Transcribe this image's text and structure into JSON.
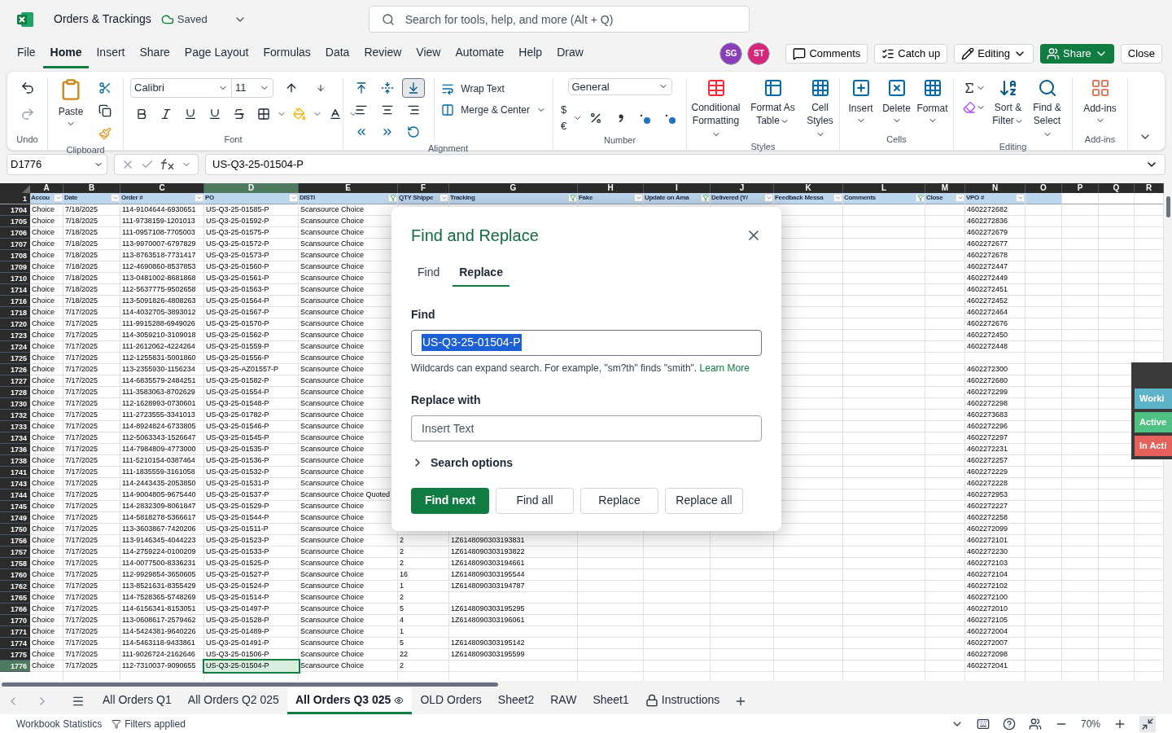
{
  "title_bar": {
    "file_name": "Orders & Trackings",
    "save_status": "Saved",
    "search": {
      "placeholder": "Search for tools, help, and more (Alt + Q)"
    }
  },
  "menu_tabs": [
    {
      "label": "File",
      "selected": false
    },
    {
      "label": "Home",
      "selected": true
    },
    {
      "label": "Insert",
      "selected": false
    },
    {
      "label": "Share",
      "selected": false
    },
    {
      "label": "Page Layout",
      "selected": false
    },
    {
      "label": "Formulas",
      "selected": false
    },
    {
      "label": "Data",
      "selected": false
    },
    {
      "label": "Review",
      "selected": false
    },
    {
      "label": "View",
      "selected": false
    },
    {
      "label": "Automate",
      "selected": false
    },
    {
      "label": "Help",
      "selected": false
    },
    {
      "label": "Draw",
      "selected": false
    }
  ],
  "collaborators": [
    {
      "initials": "SG",
      "color": "#8a3fb8"
    },
    {
      "initials": "ST",
      "color": "#d6287a"
    }
  ],
  "actions": {
    "comments": "Comments",
    "catch_up": "Catch up",
    "editing": "Editing",
    "share": "Share",
    "close": "Close"
  },
  "ribbon": {
    "undo_label": "Undo",
    "clipboard_label": "Clipboard",
    "paste": "Paste",
    "font_label": "Font",
    "font_name": "Calibri",
    "font_size": "11",
    "alignment_label": "Alignment",
    "vertical_align": [
      {
        "selected": false
      },
      {
        "selected": false
      },
      {
        "selected": true
      }
    ],
    "wrap_text": "Wrap Text",
    "merge": "Merge & Center",
    "number_label": "Number",
    "number_format": "General",
    "currency": "$€",
    "styles_label": "Styles",
    "styles": [
      "Conditional Formatting",
      "Format As Table",
      "Cell Styles"
    ],
    "cells_label": "Cells",
    "cells": [
      "Insert",
      "Delete",
      "Format"
    ],
    "editing_label": "Editing",
    "editing": [
      "Sort & Filter",
      "Find & Select"
    ],
    "addins_label": "Add-ins",
    "addins": "Add-ins"
  },
  "formula_bar": {
    "name_box": "D1776",
    "value": "US-Q3-25-01504-P"
  },
  "columns": [
    {
      "letter": "A",
      "header": "Accou",
      "in_table": true,
      "filtered": false,
      "selected": false
    },
    {
      "letter": "B",
      "header": "Date",
      "in_table": true,
      "filtered": false,
      "selected": false
    },
    {
      "letter": "C",
      "header": "Order #",
      "in_table": true,
      "filtered": false,
      "selected": false
    },
    {
      "letter": "D",
      "header": "PO",
      "in_table": true,
      "filtered": false,
      "selected": true
    },
    {
      "letter": "E",
      "header": "DISTI",
      "in_table": true,
      "filtered": true,
      "selected": false
    },
    {
      "letter": "F",
      "header": "QTY Shippe",
      "in_table": true,
      "filtered": false,
      "selected": false
    },
    {
      "letter": "G",
      "header": "Tracking",
      "in_table": true,
      "filtered": true,
      "selected": false
    },
    {
      "letter": "H",
      "header": "Fake",
      "in_table": true,
      "filtered": false,
      "selected": false
    },
    {
      "letter": "I",
      "header": "Update on Ama",
      "in_table": true,
      "filtered": true,
      "selected": false
    },
    {
      "letter": "J",
      "header": "Delivered (Y/",
      "in_table": true,
      "filtered": false,
      "selected": false
    },
    {
      "letter": "K",
      "header": "Feedback Messa",
      "in_table": true,
      "filtered": false,
      "selected": false
    },
    {
      "letter": "L",
      "header": "Comments",
      "in_table": true,
      "filtered": true,
      "selected": false
    },
    {
      "letter": "M",
      "header": "Close",
      "in_table": true,
      "filtered": false,
      "selected": false
    },
    {
      "letter": "N",
      "header": "VPO #",
      "in_table": true,
      "filtered": false,
      "selected": false
    },
    {
      "letter": "O",
      "in_table": true,
      "selected": false
    },
    {
      "letter": "P",
      "in_table": false,
      "selected": false
    },
    {
      "letter": "Q",
      "in_table": false,
      "selected": false
    },
    {
      "letter": "R",
      "in_table": false,
      "selected": false
    }
  ],
  "header_row_number": "1",
  "rows": [
    {
      "number": "1704",
      "selected": false,
      "cells": {
        "A": "Choice",
        "B": "7/18/2025",
        "C": "114-9104644-6930651",
        "D": "US-Q3-25-01585-P",
        "E": "Scansource Choice",
        "N": "4602272682"
      }
    },
    {
      "number": "1705",
      "selected": false,
      "cells": {
        "A": "Choice",
        "B": "7/18/2025",
        "C": "111-9738159-1201013",
        "D": "US-Q3-25-01592-P",
        "E": "Scansource Choice",
        "N": "4602272836"
      }
    },
    {
      "number": "1706",
      "selected": false,
      "cells": {
        "A": "Choice",
        "B": "7/18/2025",
        "C": "111-0957108-7705003",
        "D": "US-Q3-25-01575-P",
        "E": "Scansource Choice",
        "N": "4602272679"
      }
    },
    {
      "number": "1707",
      "selected": false,
      "cells": {
        "A": "Choice",
        "B": "7/18/2025",
        "C": "113-9970007-6797829",
        "D": "US-Q3-25-01572-P",
        "E": "Scansource Choice",
        "N": "4602272677"
      }
    },
    {
      "number": "1708",
      "selected": false,
      "cells": {
        "A": "Choice",
        "B": "7/18/2025",
        "C": "113-8763518-7731417",
        "D": "US-Q3-25-01573-P",
        "E": "Scansource Choice",
        "N": "4602272678"
      }
    },
    {
      "number": "1709",
      "selected": false,
      "cells": {
        "A": "Choice",
        "B": "7/18/2025",
        "C": "112-4690860-8537853",
        "D": "US-Q3-25-01560-P",
        "E": "Scansource Choice",
        "N": "4602272447"
      }
    },
    {
      "number": "1710",
      "selected": false,
      "cells": {
        "A": "Choice",
        "B": "7/18/2025",
        "C": "113-0481002-8681868",
        "D": "US-Q3-25-01561-P",
        "E": "Scansource Choice",
        "N": "4602272449"
      }
    },
    {
      "number": "1714",
      "selected": false,
      "cells": {
        "A": "Choice",
        "B": "7/18/2025",
        "C": "112-5637775-9502658",
        "D": "US-Q3-25-01563-P",
        "E": "Scansource Choice",
        "N": "4602272451"
      }
    },
    {
      "number": "1716",
      "selected": false,
      "cells": {
        "A": "Choice",
        "B": "7/18/2025",
        "C": "113-5091826-4808263",
        "D": "US-Q3-25-01564-P",
        "E": "Scansource Choice",
        "N": "4602272452"
      }
    },
    {
      "number": "1718",
      "selected": false,
      "cells": {
        "A": "Choice",
        "B": "7/17/2025",
        "C": "114-4032705-3893012",
        "D": "US-Q3-25-01567-P",
        "E": "Scansource Choice",
        "N": "4602272464"
      }
    },
    {
      "number": "1720",
      "selected": false,
      "cells": {
        "A": "Choice",
        "B": "7/17/2025",
        "C": "111-9915288-6949026",
        "D": "US-Q3-25-01570-P",
        "E": "Scansource Choice",
        "N": "4602272676"
      }
    },
    {
      "number": "1723",
      "selected": false,
      "cells": {
        "A": "Choice",
        "B": "7/17/2025",
        "C": "114-3059210-3109018",
        "D": "US-Q3-25-01562-P",
        "E": "Scansource Choice",
        "N": "4602272450"
      }
    },
    {
      "number": "1724",
      "selected": false,
      "cells": {
        "A": "Choice",
        "B": "7/17/2025",
        "C": "111-2612062-4224264",
        "D": "US-Q3-25-01559-P",
        "E": "Scansource Choice",
        "N": "4602272448"
      }
    },
    {
      "number": "1725",
      "selected": false,
      "cells": {
        "A": "Choice",
        "B": "7/17/2025",
        "C": "112-1255831-5001860",
        "D": "US-Q3-25-01556-P",
        "E": "Scansource Choice"
      }
    },
    {
      "number": "1726",
      "selected": false,
      "cells": {
        "A": "Choice",
        "B": "7/17/2025",
        "C": "113-2355930-1156234",
        "D": "US-Q3-25-AZ01557-P",
        "E": "Scansource Choice",
        "N": "4602272300"
      }
    },
    {
      "number": "1727",
      "selected": false,
      "cells": {
        "A": "Choice",
        "B": "7/17/2025",
        "C": "114-6835579-2484251",
        "D": "US-Q3-25-01582-P",
        "E": "Scansource Choice",
        "N": "4602272680"
      }
    },
    {
      "number": "1728",
      "selected": false,
      "cells": {
        "A": "Choice",
        "B": "7/17/2025",
        "C": "111-3583063-8702629",
        "D": "US-Q3-25-01554-P",
        "E": "Scansource Choice",
        "N": "4602272299"
      }
    },
    {
      "number": "1730",
      "selected": false,
      "cells": {
        "A": "Choice",
        "B": "7/17/2025",
        "C": "112-1628993-0730601",
        "D": "US-Q3-25-01548-P",
        "E": "Scansource Choice",
        "N": "4602272298"
      }
    },
    {
      "number": "1732",
      "selected": false,
      "cells": {
        "A": "Choice",
        "B": "7/17/2025",
        "C": "111-2723555-3341013",
        "D": "US-Q3-25-01782-P",
        "E": "Scansource Choice",
        "N": "4602273683"
      }
    },
    {
      "number": "1733",
      "selected": false,
      "cells": {
        "A": "Choice",
        "B": "7/17/2025",
        "C": "114-8924824-6733805",
        "D": "US-Q3-25-01546-P",
        "E": "Scansource Choice",
        "N": "4602272296"
      }
    },
    {
      "number": "1734",
      "selected": false,
      "cells": {
        "A": "Choice",
        "B": "7/17/2025",
        "C": "112-5063343-1526647",
        "D": "US-Q3-25-01545-P",
        "E": "Scansource Choice",
        "N": "4602272297"
      }
    },
    {
      "number": "1736",
      "selected": false,
      "cells": {
        "A": "Choice",
        "B": "7/17/2025",
        "C": "114-7984809-4773000",
        "D": "US-Q3-25-01535-P",
        "E": "Scansource Choice",
        "N": "4602272231"
      }
    },
    {
      "number": "1738",
      "selected": false,
      "cells": {
        "A": "Choice",
        "B": "7/17/2025",
        "C": "111-5210154-0387464",
        "D": "US-Q3-25-01536-P",
        "E": "Scansource Choice",
        "N": "4602272257"
      }
    },
    {
      "number": "1741",
      "selected": false,
      "cells": {
        "A": "Choice",
        "B": "7/17/2025",
        "C": "111-1835559-3161058",
        "D": "US-Q3-25-01532-P",
        "E": "Scansource Choice",
        "N": "4602272229"
      }
    },
    {
      "number": "1743",
      "selected": false,
      "cells": {
        "A": "Choice",
        "B": "7/17/2025",
        "C": "114-2443435-2053850",
        "D": "US-Q3-25-01531-P",
        "E": "Scansource Choice",
        "N": "4602272228"
      }
    },
    {
      "number": "1744",
      "selected": false,
      "cells": {
        "A": "Choice",
        "B": "7/17/2025",
        "C": "114-9004805-9675440",
        "D": "US-Q3-25-01537-P",
        "E": "Scansource Choice Quoted",
        "N": "4602272953"
      }
    },
    {
      "number": "1745",
      "selected": false,
      "cells": {
        "A": "Choice",
        "B": "7/17/2025",
        "C": "114-2832309-8061847",
        "D": "US-Q3-25-01529-P",
        "E": "Scansource Choice",
        "N": "4602272227"
      }
    },
    {
      "number": "1749",
      "selected": false,
      "cells": {
        "A": "Choice",
        "B": "7/17/2025",
        "C": "114-5818278-5366617",
        "D": "US-Q3-25-01544-P",
        "E": "Scansource Choice",
        "N": "4602272258"
      }
    },
    {
      "number": "1750",
      "selected": false,
      "cells": {
        "A": "Choice",
        "B": "7/17/2025",
        "C": "113-3603867-7420206",
        "D": "US-Q3-25-01511-P",
        "E": "Scansource Choice",
        "N": "4602272099"
      }
    },
    {
      "number": "1756",
      "selected": false,
      "cells": {
        "A": "Choice",
        "B": "7/17/2025",
        "C": "113-9146345-4044223",
        "D": "US-Q3-25-01523-P",
        "E": "Scansource Choice",
        "F": "2",
        "G": "1Z6148090303193831",
        "N": "4602272101"
      }
    },
    {
      "number": "1757",
      "selected": false,
      "cells": {
        "A": "Choice",
        "B": "7/17/2025",
        "C": "114-2759224-0100209",
        "D": "US-Q3-25-01533-P",
        "E": "Scansource Choice",
        "F": "2",
        "G": "1Z6148090303193822",
        "N": "4602272230"
      }
    },
    {
      "number": "1758",
      "selected": false,
      "cells": {
        "A": "Choice",
        "B": "7/17/2025",
        "C": "114-0077500-8336231",
        "D": "US-Q3-25-01525-P",
        "E": "Scansource Choice",
        "F": "2",
        "G": "1Z6148090303194661",
        "N": "4602272103"
      }
    },
    {
      "number": "1760",
      "selected": false,
      "cells": {
        "A": "Choice",
        "B": "7/17/2025",
        "C": "112-9929854-3650605",
        "D": "US-Q3-25-01527-P",
        "E": "Scansource Choice",
        "F": "16",
        "G": "1Z6148090303195544",
        "N": "4602272104"
      }
    },
    {
      "number": "1762",
      "selected": false,
      "cells": {
        "A": "Choice",
        "B": "7/17/2025",
        "C": "113-8521631-8355429",
        "D": "US-Q3-25-01524-P",
        "E": "Scansource Choice",
        "F": "1",
        "G": "1Z6148090303194787",
        "N": "4602272102"
      }
    },
    {
      "number": "1765",
      "selected": false,
      "cells": {
        "A": "Choice",
        "B": "7/17/2025",
        "C": "114-7528365-5748269",
        "D": "US-Q3-25-01514-P",
        "E": "Scansource Choice",
        "F": "2",
        "N": "4602272100"
      }
    },
    {
      "number": "1766",
      "selected": false,
      "cells": {
        "A": "Choice",
        "B": "7/17/2025",
        "C": "114-6156341-8153051",
        "D": "US-Q3-25-01497-P",
        "E": "Scansource Choice",
        "F": "5",
        "G": "1Z6148090303195295",
        "N": "4602272010"
      }
    },
    {
      "number": "1770",
      "selected": false,
      "cells": {
        "A": "Choice",
        "B": "7/17/2025",
        "C": "113-0608617-2579462",
        "D": "US-Q3-25-01528-P",
        "E": "Scansource Choice",
        "F": "4",
        "G": "1Z6148090303196061",
        "N": "4602272105"
      }
    },
    {
      "number": "1771",
      "selected": false,
      "cells": {
        "A": "Choice",
        "B": "7/17/2025",
        "C": "114-5424381-9640226",
        "D": "US-Q3-25-01489-P",
        "E": "Scansource Choice",
        "F": "1",
        "N": "4602272004"
      }
    },
    {
      "number": "1774",
      "selected": false,
      "cells": {
        "A": "Choice",
        "B": "7/17/2025",
        "C": "114-5463118-9433861",
        "D": "US-Q3-25-01491-P",
        "E": "Scansource Choice",
        "F": "5",
        "G": "1Z6148090303195142",
        "N": "4602272007"
      }
    },
    {
      "number": "1775",
      "selected": false,
      "cells": {
        "A": "Choice",
        "B": "7/17/2025",
        "C": "111-9026724-2162646",
        "D": "US-Q3-25-01506-P",
        "E": "Scansource Choice",
        "F": "22",
        "G": "1Z6148090303195599",
        "N": "4602272098"
      }
    },
    {
      "number": "1776",
      "selected": true,
      "cells": {
        "A": "Choice",
        "B": "7/17/2025",
        "C": "112-7310037-9090655",
        "D": "US-Q3-25-01504-P",
        "E": "Scansource Choice",
        "F": "2",
        "N": "4602272041"
      }
    }
  ],
  "status_panel": [
    {
      "label": "Worki",
      "color": "#5fb3c9"
    },
    {
      "label": "Active",
      "color": "#4fc283"
    },
    {
      "label": "In Acti",
      "color": "#e4625b"
    }
  ],
  "dialog": {
    "title": "Find and Replace",
    "tabs": [
      {
        "label": "Find",
        "selected": false
      },
      {
        "label": "Replace",
        "selected": true
      }
    ],
    "find_label": "Find",
    "find_value": "US-Q3-25-01504-P",
    "hint": "Wildcards can expand search. For example, \"sm?th\" finds \"smith\".",
    "hint_link": "Learn More",
    "replace_label": "Replace with",
    "replace_placeholder": "Insert Text",
    "search_options": {
      "label": "Search options",
      "expanded": false
    },
    "buttons": [
      {
        "label": "Find next",
        "kind": "primary"
      },
      {
        "label": "Find all",
        "kind": "secondary"
      },
      {
        "label": "Replace",
        "kind": "secondary"
      },
      {
        "label": "Replace all",
        "kind": "secondary"
      }
    ]
  },
  "sheet_tabs": [
    {
      "label": "All Orders Q1",
      "selected": false,
      "kind": "plain"
    },
    {
      "label": "All Orders Q2 025",
      "selected": false,
      "kind": "plain"
    },
    {
      "label": "All Orders Q3 025",
      "selected": true,
      "kind": "viewed"
    },
    {
      "label": "OLD Orders",
      "selected": false,
      "kind": "plain"
    },
    {
      "label": "Sheet2",
      "selected": false,
      "kind": "plain"
    },
    {
      "label": "RAW",
      "selected": false,
      "kind": "plain"
    },
    {
      "label": "Sheet1",
      "selected": false,
      "kind": "plain"
    },
    {
      "label": "Instructions",
      "selected": false,
      "kind": "locked"
    }
  ],
  "status_bar": {
    "statistics": "Workbook Statistics",
    "filters": "Filters applied",
    "zoom": "70%"
  }
}
